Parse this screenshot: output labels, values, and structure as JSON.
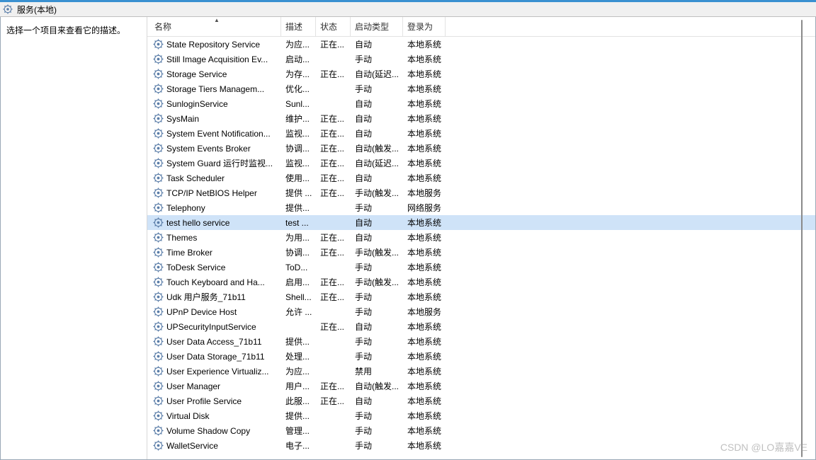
{
  "title": "服务(本地)",
  "left_panel": {
    "hint": "选择一个项目来查看它的描述。"
  },
  "columns": {
    "name": "名称",
    "desc": "描述",
    "status": "状态",
    "startup": "启动类型",
    "logon": "登录为"
  },
  "selected_index": 12,
  "services": [
    {
      "name": "State Repository Service",
      "desc": "为应...",
      "status": "正在...",
      "startup": "自动",
      "logon": "本地系统"
    },
    {
      "name": "Still Image Acquisition Ev...",
      "desc": "启动...",
      "status": "",
      "startup": "手动",
      "logon": "本地系统"
    },
    {
      "name": "Storage Service",
      "desc": "为存...",
      "status": "正在...",
      "startup": "自动(延迟...",
      "logon": "本地系统"
    },
    {
      "name": "Storage Tiers Managem...",
      "desc": "优化...",
      "status": "",
      "startup": "手动",
      "logon": "本地系统"
    },
    {
      "name": "SunloginService",
      "desc": "Sunl...",
      "status": "",
      "startup": "自动",
      "logon": "本地系统"
    },
    {
      "name": "SysMain",
      "desc": "维护...",
      "status": "正在...",
      "startup": "自动",
      "logon": "本地系统"
    },
    {
      "name": "System Event Notification...",
      "desc": "监视...",
      "status": "正在...",
      "startup": "自动",
      "logon": "本地系统"
    },
    {
      "name": "System Events Broker",
      "desc": "协调...",
      "status": "正在...",
      "startup": "自动(触发...",
      "logon": "本地系统"
    },
    {
      "name": "System Guard 运行时监视...",
      "desc": "监视...",
      "status": "正在...",
      "startup": "自动(延迟...",
      "logon": "本地系统"
    },
    {
      "name": "Task Scheduler",
      "desc": "使用...",
      "status": "正在...",
      "startup": "自动",
      "logon": "本地系统"
    },
    {
      "name": "TCP/IP NetBIOS Helper",
      "desc": "提供 ...",
      "status": "正在...",
      "startup": "手动(触发...",
      "logon": "本地服务"
    },
    {
      "name": "Telephony",
      "desc": "提供...",
      "status": "",
      "startup": "手动",
      "logon": "网络服务"
    },
    {
      "name": "test hello service",
      "desc": "test ...",
      "status": "",
      "startup": "自动",
      "logon": "本地系统"
    },
    {
      "name": "Themes",
      "desc": "为用...",
      "status": "正在...",
      "startup": "自动",
      "logon": "本地系统"
    },
    {
      "name": "Time Broker",
      "desc": "协调...",
      "status": "正在...",
      "startup": "手动(触发...",
      "logon": "本地系统"
    },
    {
      "name": "ToDesk Service",
      "desc": "ToD...",
      "status": "",
      "startup": "手动",
      "logon": "本地系统"
    },
    {
      "name": "Touch Keyboard and Ha...",
      "desc": "启用...",
      "status": "正在...",
      "startup": "手动(触发...",
      "logon": "本地系统"
    },
    {
      "name": "Udk 用户服务_71b11",
      "desc": "Shell...",
      "status": "正在...",
      "startup": "手动",
      "logon": "本地系统"
    },
    {
      "name": "UPnP Device Host",
      "desc": "允许 ...",
      "status": "",
      "startup": "手动",
      "logon": "本地服务"
    },
    {
      "name": "UPSecurityInputService",
      "desc": "",
      "status": "正在...",
      "startup": "自动",
      "logon": "本地系统"
    },
    {
      "name": "User Data Access_71b11",
      "desc": "提供...",
      "status": "",
      "startup": "手动",
      "logon": "本地系统"
    },
    {
      "name": "User Data Storage_71b11",
      "desc": "处理...",
      "status": "",
      "startup": "手动",
      "logon": "本地系统"
    },
    {
      "name": "User Experience Virtualiz...",
      "desc": "为应...",
      "status": "",
      "startup": "禁用",
      "logon": "本地系统"
    },
    {
      "name": "User Manager",
      "desc": "用户...",
      "status": "正在...",
      "startup": "自动(触发...",
      "logon": "本地系统"
    },
    {
      "name": "User Profile Service",
      "desc": "此服...",
      "status": "正在...",
      "startup": "自动",
      "logon": "本地系统"
    },
    {
      "name": "Virtual Disk",
      "desc": "提供...",
      "status": "",
      "startup": "手动",
      "logon": "本地系统"
    },
    {
      "name": "Volume Shadow Copy",
      "desc": "管理...",
      "status": "",
      "startup": "手动",
      "logon": "本地系统"
    },
    {
      "name": "WalletService",
      "desc": "电子...",
      "status": "",
      "startup": "手动",
      "logon": "本地系统"
    }
  ],
  "watermark": "CSDN @LO嘉嘉VE"
}
